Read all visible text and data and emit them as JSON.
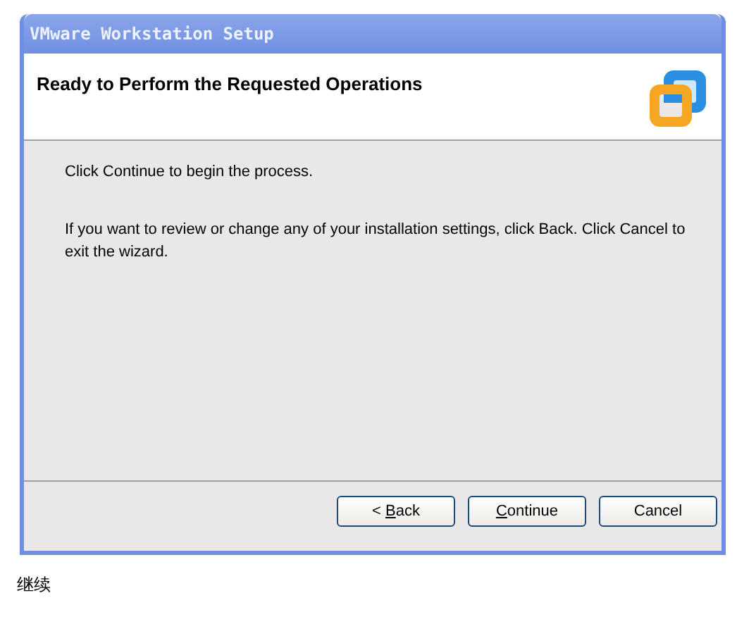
{
  "window": {
    "title": "VMware Workstation Setup"
  },
  "header": {
    "title": "Ready to Perform the Requested Operations"
  },
  "body": [
    "Click Continue to begin the process.",
    "If you want to review or change any of your installation settings, click Back. Click Cancel to exit the wizard."
  ],
  "buttons": [
    {
      "before": "< ",
      "key": "B",
      "after": "ack"
    },
    {
      "key": "C",
      "after": "ontinue"
    },
    {
      "before": "Cancel"
    }
  ],
  "caption": "继续"
}
